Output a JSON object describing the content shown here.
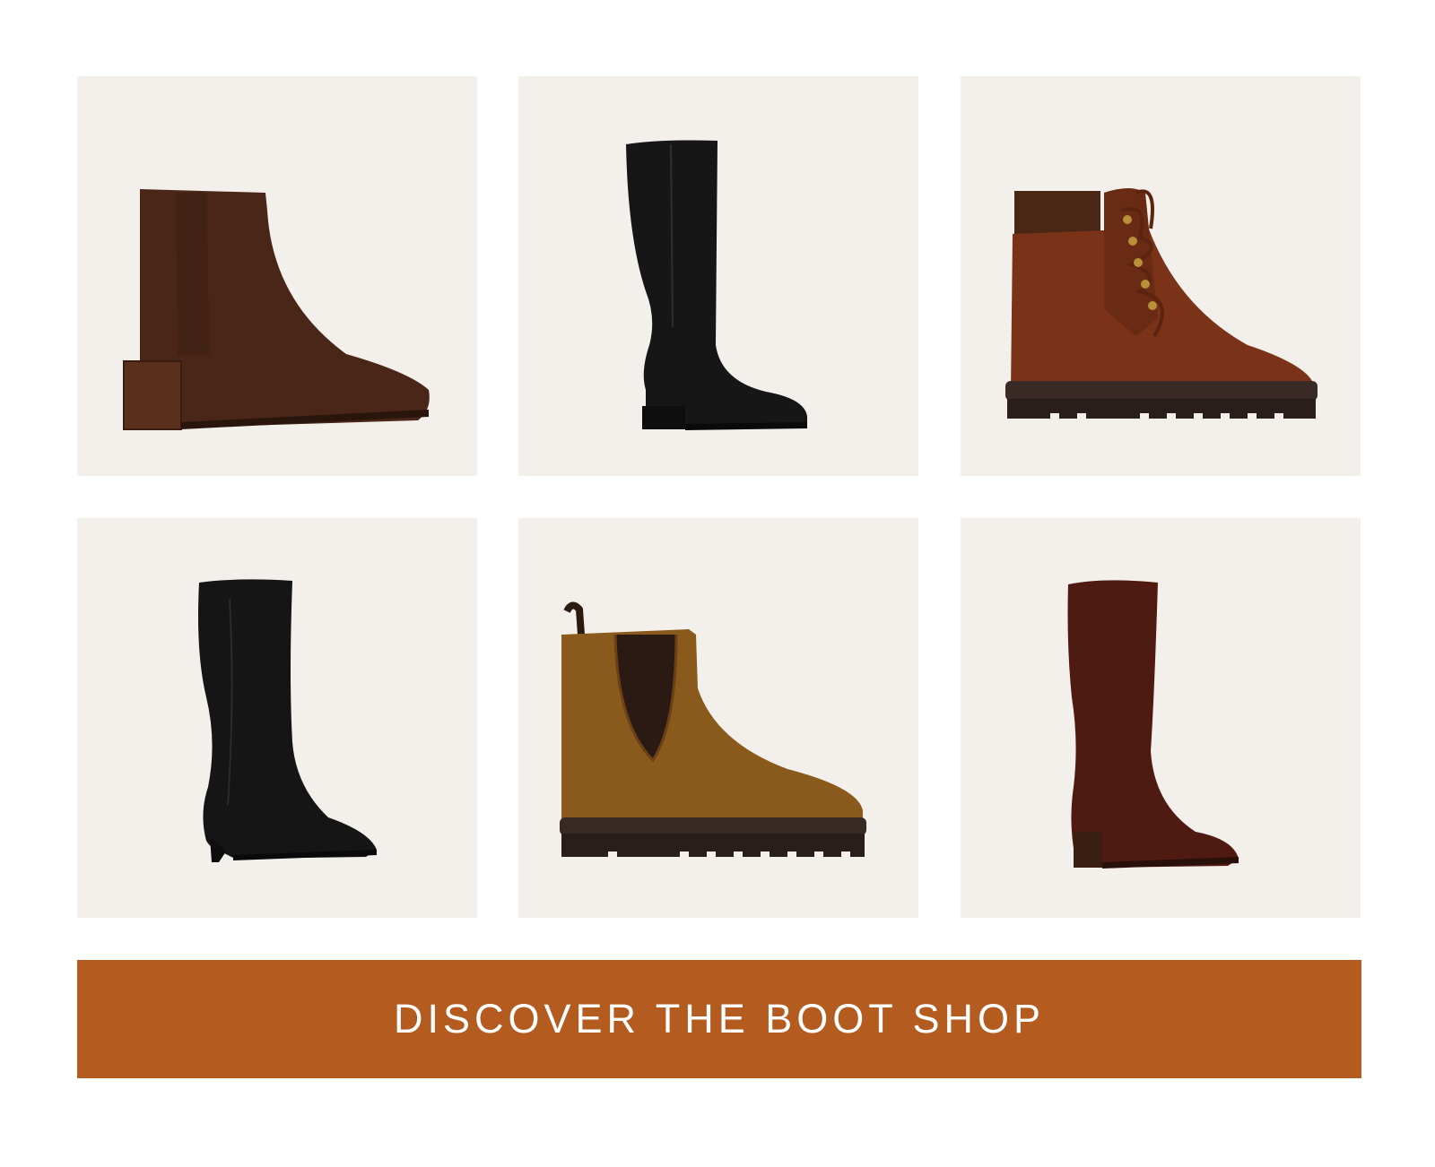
{
  "products": [
    {
      "name": "brown suede block-heel ankle boot",
      "icon": "ankle-boot-icon",
      "color": "#4a2619"
    },
    {
      "name": "black leather knee-high riding boot",
      "icon": "riding-boot-icon",
      "color": "#161616"
    },
    {
      "name": "cognac leather lace-up hiker boot",
      "icon": "hiker-boot-icon",
      "color": "#7a3218"
    },
    {
      "name": "black kitten-heel knee-high boot",
      "icon": "kitten-heel-boot-icon",
      "color": "#151515"
    },
    {
      "name": "tan suede lug-sole chelsea boot",
      "icon": "chelsea-boot-icon",
      "color": "#8a5a1c"
    },
    {
      "name": "burgundy suede knee-high boot",
      "icon": "knee-high-boot-icon",
      "color": "#4f1a12"
    }
  ],
  "cta": {
    "label": "DISCOVER THE BOOT SHOP",
    "background": "#b45c1f",
    "text_color": "#ffffff"
  },
  "tile_background": "#f3efeb"
}
